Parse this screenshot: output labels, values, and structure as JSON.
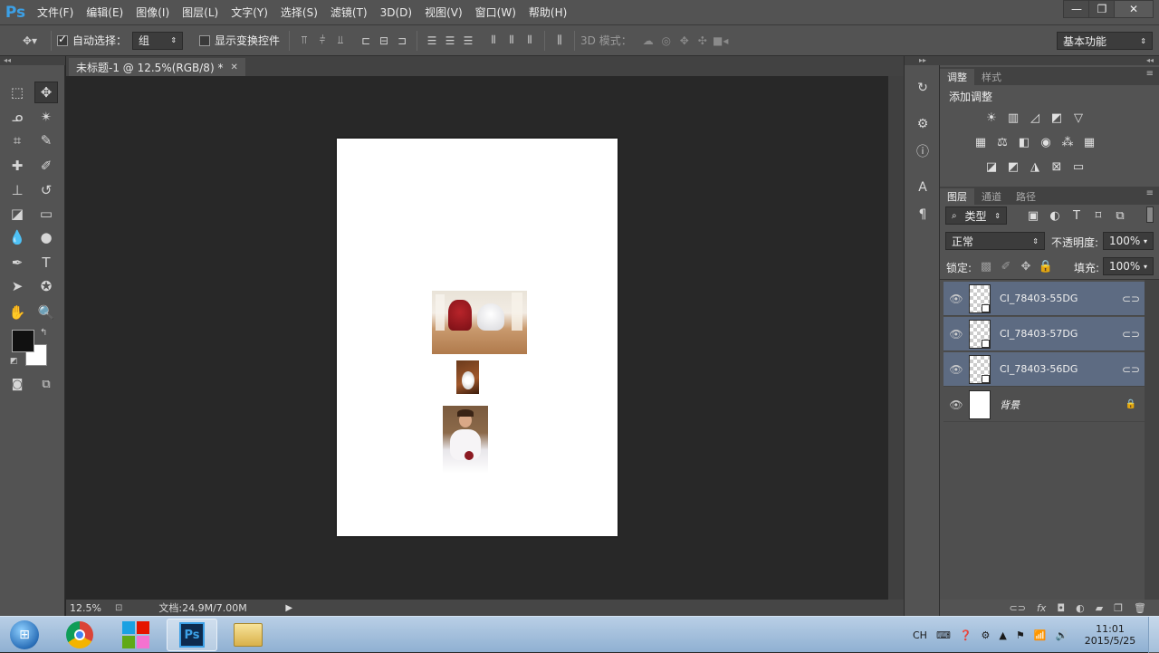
{
  "app": {
    "logo": "Ps"
  },
  "menu": [
    "文件(F)",
    "编辑(E)",
    "图像(I)",
    "图层(L)",
    "文字(Y)",
    "选择(S)",
    "滤镜(T)",
    "3D(D)",
    "视图(V)",
    "窗口(W)",
    "帮助(H)"
  ],
  "window_controls": {
    "minimize": "—",
    "restore": "❐",
    "close": "✕"
  },
  "options": {
    "auto_select_label": "自动选择：",
    "auto_select_value": "组",
    "transform_label": "显示变换控件",
    "mode3d_label": "3D 模式：",
    "workspace": "基本功能"
  },
  "document": {
    "tab_title": "未标题-1 @ 12.5%(RGB/8) *",
    "tab_close": "✕"
  },
  "status": {
    "zoom": "12.5%",
    "doc_info": "文档:24.9M/7.00M"
  },
  "adjustments_panel": {
    "tabs": [
      "调整",
      "样式"
    ],
    "heading": "添加调整"
  },
  "layers_panel": {
    "tabs": [
      "图层",
      "通道",
      "路径"
    ],
    "filter_kind": "类型",
    "blend_mode": "正常",
    "opacity_label": "不透明度:",
    "opacity_value": "100%",
    "lock_label": "锁定:",
    "fill_label": "填充:",
    "fill_value": "100%",
    "layers": [
      {
        "name": "CI_78403-55DG",
        "selected": true
      },
      {
        "name": "CI_78403-57DG",
        "selected": true
      },
      {
        "name": "CI_78403-56DG",
        "selected": true
      },
      {
        "name": "背景",
        "selected": false
      }
    ]
  },
  "taskbar": {
    "lang": "CH",
    "time": "11:01",
    "date": "2015/5/25",
    "apps": [
      "start",
      "chrome",
      "app-tiles",
      "photoshop",
      "explorer"
    ]
  }
}
